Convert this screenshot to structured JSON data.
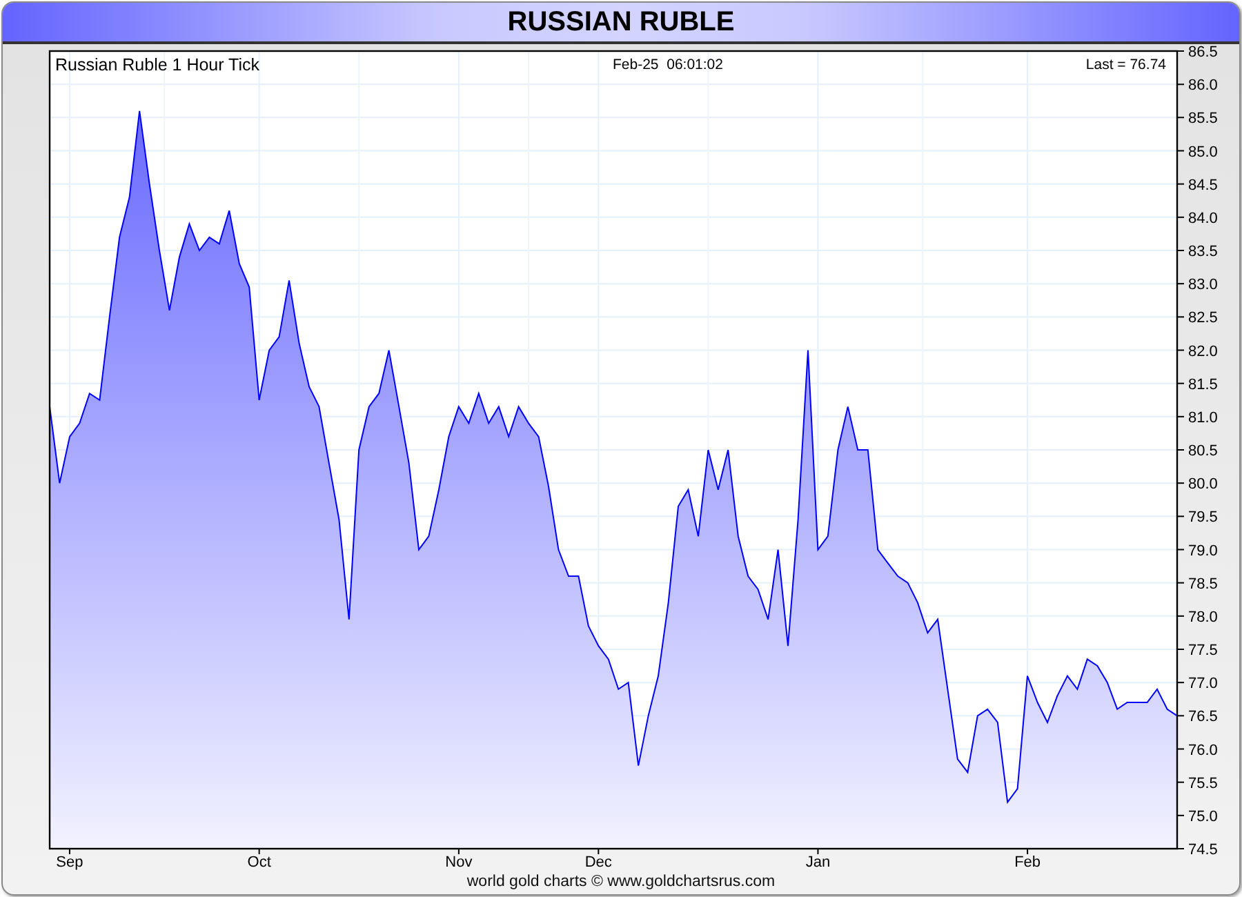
{
  "window": {
    "title": "RUSSIAN RUBLE"
  },
  "chart": {
    "header_left": "Russian Ruble 1 Hour Tick",
    "header_center": "Feb-25  06:01:02",
    "header_right": "Last = 76.74",
    "chart_data": {
      "type": "area",
      "grid": true,
      "ylim": [
        74.5,
        86.5
      ],
      "categories": [
        null,
        null,
        "Sep",
        null,
        null,
        null,
        null,
        null,
        null,
        null,
        null,
        null,
        null,
        null,
        null,
        null,
        null,
        null,
        null,
        null,
        null,
        "Oct",
        null,
        null,
        null,
        null,
        null,
        null,
        null,
        null,
        null,
        null,
        null,
        null,
        null,
        null,
        null,
        null,
        null,
        null,
        null,
        "Nov",
        null,
        null,
        null,
        null,
        null,
        null,
        null,
        null,
        null,
        null,
        null,
        null,
        null,
        "Dec",
        null,
        null,
        null,
        null,
        null,
        null,
        null,
        null,
        null,
        null,
        null,
        null,
        null,
        null,
        null,
        null,
        null,
        null,
        null,
        null,
        null,
        "Jan",
        null,
        null,
        null,
        null,
        null,
        null,
        null,
        null,
        null,
        null,
        null,
        null,
        null,
        null,
        null,
        null,
        null,
        null,
        null,
        null,
        "Feb",
        null,
        null,
        null,
        null,
        null,
        null,
        null,
        null,
        null,
        null,
        null,
        null,
        null,
        null,
        null
      ],
      "yticks": [
        74.5,
        {
          "value": 75,
          "label": "75.0"
        },
        75.5,
        {
          "value": 76,
          "label": "76.0"
        },
        76.5,
        {
          "value": 77,
          "label": "77.0"
        },
        77.5,
        {
          "value": 78,
          "label": "78.0"
        },
        78.5,
        {
          "value": 79,
          "label": "79.0"
        },
        79.5,
        {
          "value": 80,
          "label": "80.0"
        },
        80.5,
        {
          "value": 81,
          "label": "81.0"
        },
        81.5,
        {
          "value": 82,
          "label": "82.0"
        },
        82.5,
        {
          "value": 83,
          "label": "83.0"
        },
        83.5,
        {
          "value": 84,
          "label": "84.0"
        },
        84.5,
        {
          "value": 85,
          "label": "85.0"
        },
        85.5,
        {
          "value": 86,
          "label": "86.0"
        },
        86.5
      ],
      "series": [
        {
          "color": "#0000ff",
          "values": [
            81.15,
            80.0,
            80.7,
            80.9,
            81.35,
            81.25,
            82.5,
            83.7,
            84.3,
            85.6,
            84.5,
            83.5,
            82.6,
            83.4,
            83.9,
            83.5,
            83.7,
            83.6,
            84.1,
            83.3,
            82.95,
            81.25,
            82.0,
            82.2,
            83.05,
            82.1,
            81.45,
            81.15,
            80.3,
            79.45,
            77.95,
            80.5,
            81.15,
            81.35,
            82.0,
            81.15,
            80.3,
            79.0,
            79.2,
            79.9,
            80.7,
            81.15,
            80.9,
            81.35,
            80.9,
            81.15,
            80.7,
            81.15,
            80.9,
            80.7,
            79.95,
            79.0,
            78.6,
            78.6,
            77.85,
            77.55,
            77.35,
            76.9,
            77.0,
            75.75,
            76.5,
            77.1,
            78.2,
            79.65,
            79.9,
            79.2,
            80.5,
            79.9,
            80.5,
            79.2,
            78.6,
            78.4,
            77.95,
            79.0,
            77.55,
            79.45,
            82.0,
            79.0,
            79.2,
            80.5,
            81.15,
            80.5,
            80.5,
            79.0,
            78.8,
            78.6,
            78.5,
            78.2,
            77.75,
            77.95,
            76.9,
            75.85,
            75.65,
            76.5,
            76.6,
            76.4,
            75.2,
            75.4,
            77.1,
            76.7,
            76.4,
            76.8,
            77.1,
            76.9,
            77.35,
            77.25,
            77.0,
            76.6,
            76.7,
            76.7,
            76.7,
            76.9,
            76.6,
            76.5
          ]
        }
      ]
    }
  },
  "footer": "world gold charts © www.goldchartsrus.com"
}
